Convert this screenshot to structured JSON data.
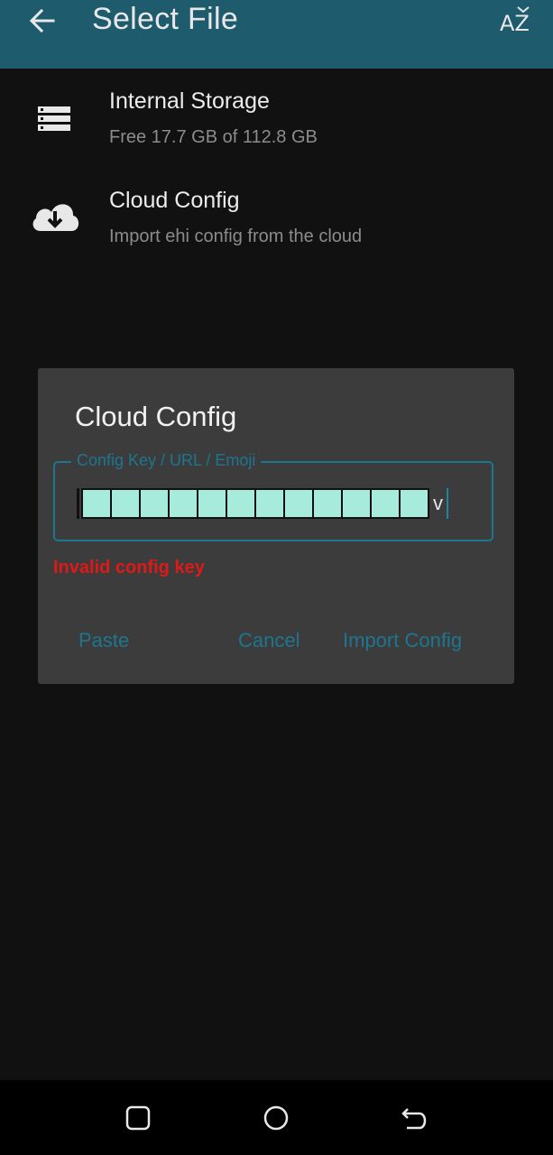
{
  "app_bar": {
    "title": "Select File",
    "back_icon": "arrow-left-icon",
    "sort_icon": "sort-az-icon",
    "sort_label": "AZ"
  },
  "items": [
    {
      "title": "Internal Storage",
      "subtitle": "Free 17.7 GB of 112.8 GB",
      "icon": "storage-icon"
    },
    {
      "title": "Cloud Config",
      "subtitle": "Import ehi config from the cloud",
      "icon": "cloud-download-icon"
    }
  ],
  "dialog": {
    "title": "Cloud Config",
    "field_label": "Config Key / URL / Emoji",
    "field_trailing_char": "v",
    "error": "Invalid config key",
    "paste_label": "Paste",
    "cancel_label": "Cancel",
    "import_label": "Import Config"
  },
  "colors": {
    "app_bar": "#1d5b6d",
    "accent": "#1d7690",
    "error": "#e01818",
    "dialog_bg": "#3c3c3c",
    "background": "#111111"
  }
}
